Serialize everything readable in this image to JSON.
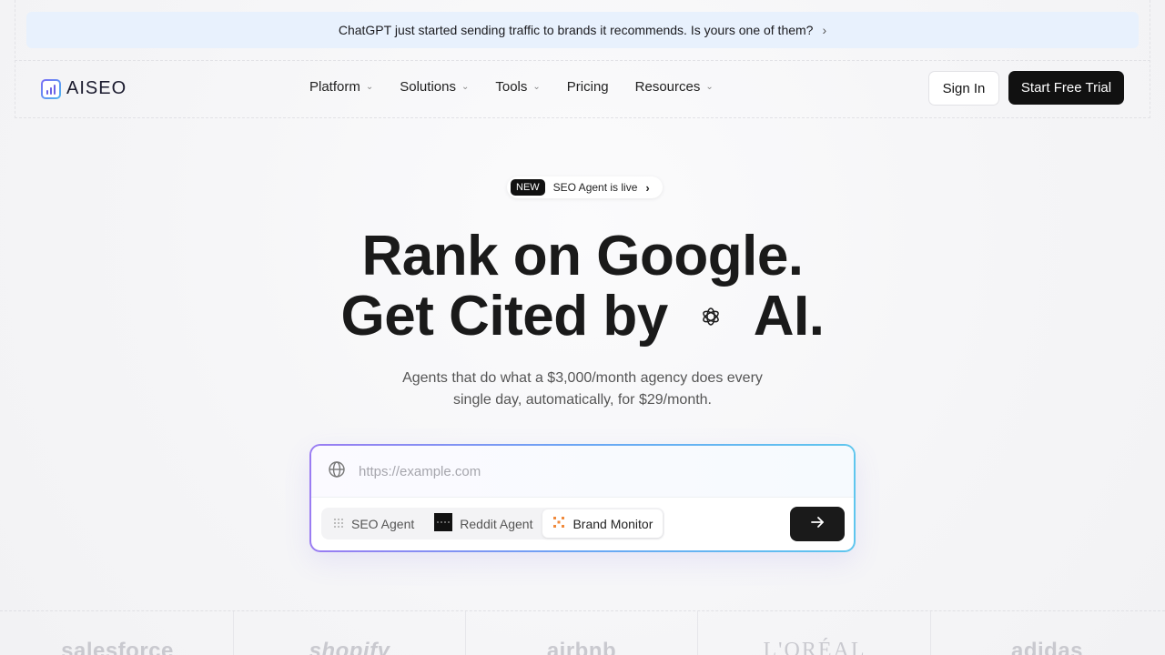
{
  "banner": {
    "text": "ChatGPT just started sending traffic to brands it recommends. Is yours one of them?",
    "chevron": "›"
  },
  "nav": {
    "logo_text": "AISEO",
    "items": [
      {
        "label": "Platform",
        "has_caret": true
      },
      {
        "label": "Solutions",
        "has_caret": true
      },
      {
        "label": "Tools",
        "has_caret": true
      },
      {
        "label": "Pricing",
        "has_caret": false
      },
      {
        "label": "Resources",
        "has_caret": true
      }
    ],
    "caret": "⌄",
    "signin_label": "Sign In",
    "trial_label": "Start Free Trial"
  },
  "hero": {
    "pill_badge": "NEW",
    "pill_text": "SEO Agent is live",
    "pill_chevron": "›",
    "headline_line1": "Rank on Google.",
    "headline_line2_a": "Get Cited by",
    "headline_line2_b": "AI.",
    "sub_line1": "Agents that do what a $3,000/month agency does every",
    "sub_line2": "single day, automatically, for $29/month."
  },
  "search": {
    "placeholder": "https://example.com",
    "value": "",
    "tabs": [
      {
        "label": "SEO Agent",
        "icon": "dots-grid-icon",
        "active": false
      },
      {
        "label": "Reddit Agent",
        "icon": "reddit-pixel-icon",
        "active": false
      },
      {
        "label": "Brand Monitor",
        "icon": "orange-spark-icon",
        "active": true
      }
    ]
  },
  "brands": [
    "salesforce",
    "shopify",
    "airbnb",
    "L'ORÉAL",
    "adidas"
  ],
  "colors": {
    "banner_bg": "#e8f1fd",
    "primary_dark": "#111111",
    "gradient_start": "#9a7cf2",
    "gradient_end": "#5fc6ee",
    "brand_monitor_accent": "#f08a3c"
  }
}
